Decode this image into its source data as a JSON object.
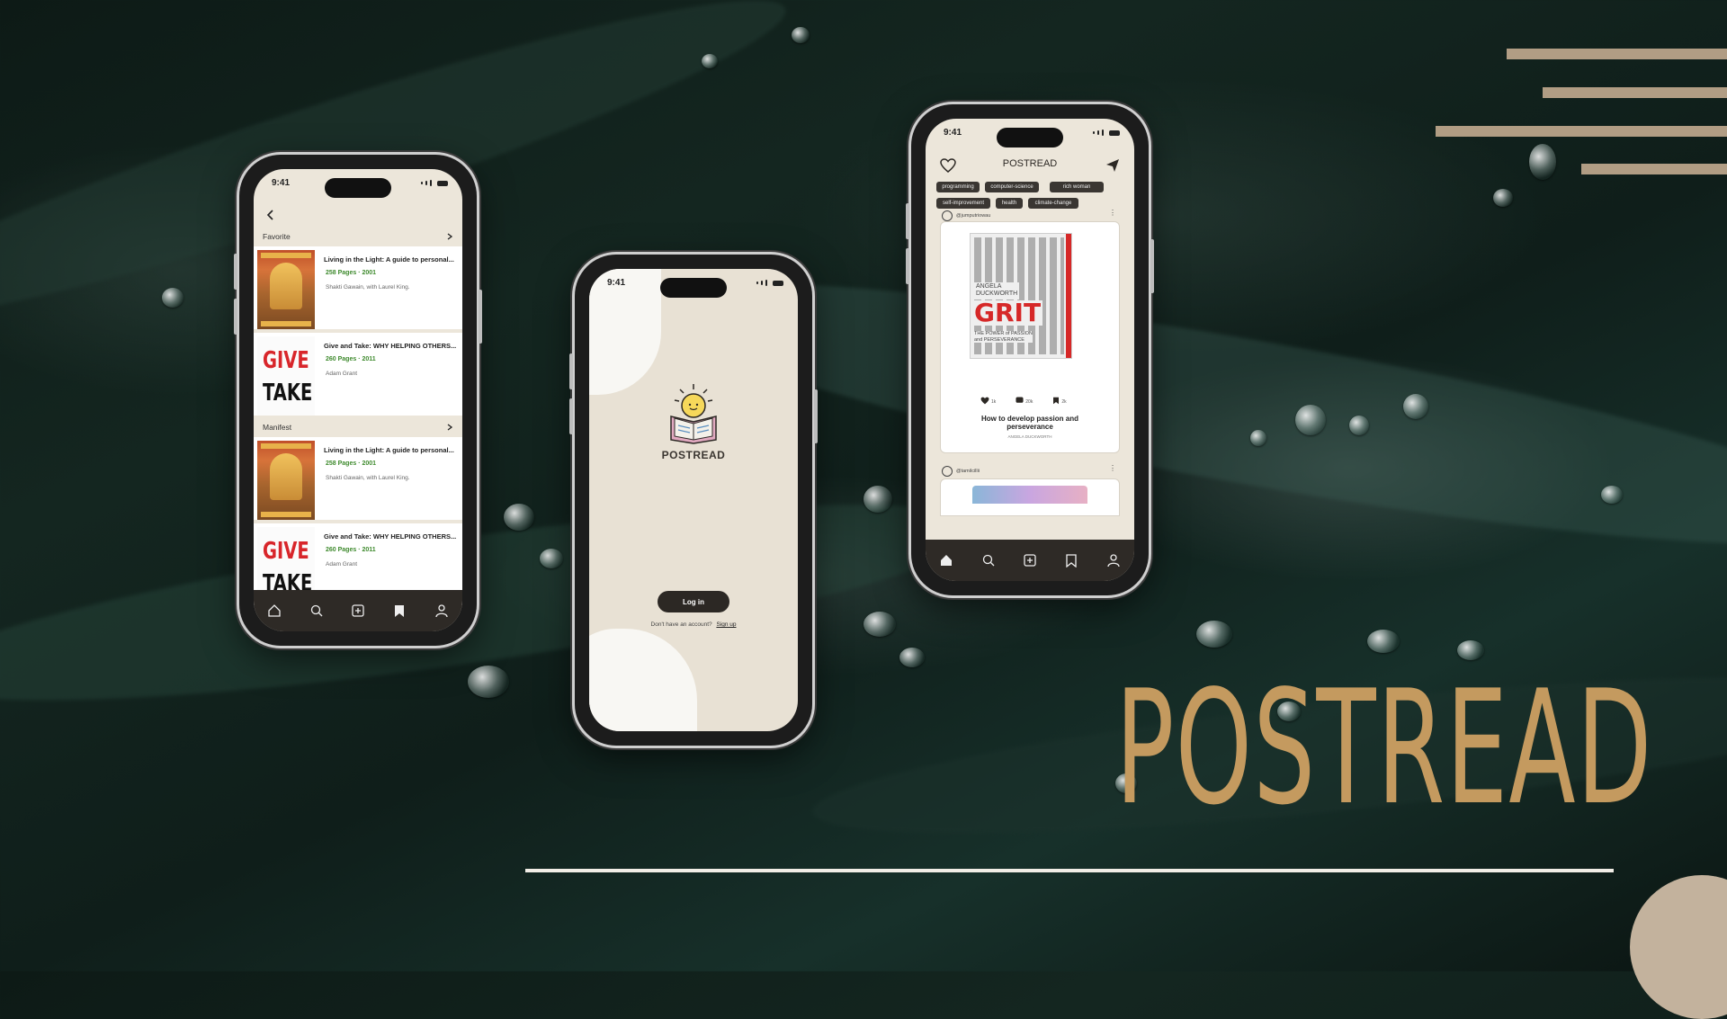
{
  "brand": {
    "title": "POSTREAD"
  },
  "colors": {
    "accent_gold": "#c49a5f",
    "deco_tan": "#b19d84",
    "tab_bar": "#2e2a26"
  },
  "phone_list": {
    "time": "9:41",
    "sections": [
      {
        "label": "Favorite",
        "books": [
          {
            "title": "Living in the Light: A guide to personal...",
            "meta": "258 Pages · 2001",
            "author": "Shakti Gawain, with Laurel King.",
            "cover": "orange"
          },
          {
            "title": "Give and Take: WHY HELPING OTHERS...",
            "meta": "260 Pages · 2011",
            "author": "Adam Grant",
            "cover": "give-take"
          }
        ]
      },
      {
        "label": "Manifest",
        "books": [
          {
            "title": "Living in the Light: A guide to personal...",
            "meta": "258 Pages · 2001",
            "author": "Shakti Gawain, with Laurel King.",
            "cover": "orange"
          },
          {
            "title": "Give and Take: WHY HELPING OTHERS...",
            "meta": "260 Pages · 2011",
            "author": "Adam Grant",
            "cover": "give-take"
          }
        ]
      }
    ],
    "cover_text": {
      "give": "GIVE",
      "take": "TAKE"
    },
    "tabs": [
      "home-icon",
      "search-icon",
      "add-icon",
      "bookmark-icon",
      "profile-icon"
    ],
    "active_tab": "bookmark-icon"
  },
  "phone_login": {
    "time": "9:41",
    "brand": "POSTREAD",
    "login_label": "Log in",
    "no_account_text": "Don't have an account?",
    "signup_label": "Sign up"
  },
  "phone_feed": {
    "time": "9:41",
    "title": "POSTREAD",
    "chips": [
      "programming",
      "computer-science",
      "rich woman",
      "self-improvement",
      "health",
      "climate-change"
    ],
    "posts": [
      {
        "user": "@jumputriowau",
        "cover_author": "ANGELA\nDUCKWORTH",
        "cover_title": "GRIT",
        "cover_subtitle": "THE POWER of PASSION\nand PERSEVERANCE",
        "likes": "1k",
        "comments": "20k",
        "saves": "2k",
        "caption": "How to develop passion and perseverance",
        "caption_sub": "ANGELA DUCKWORTH"
      },
      {
        "user": "@tamilcillii"
      }
    ],
    "tabs": [
      "home-icon",
      "search-icon",
      "add-icon",
      "bookmark-icon",
      "profile-icon"
    ],
    "active_tab": "home-icon"
  }
}
